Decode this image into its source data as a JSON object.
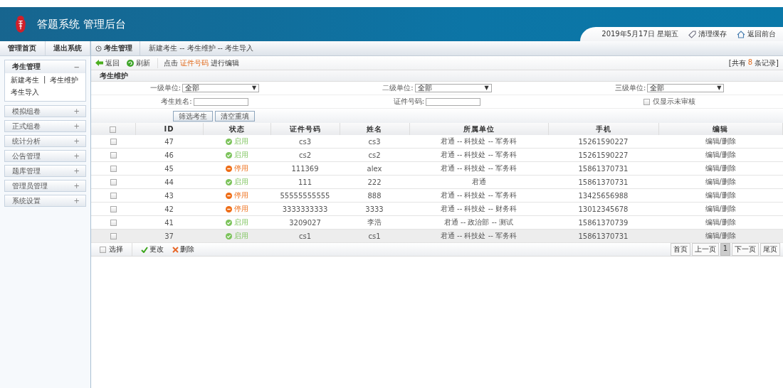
{
  "header": {
    "title": "答题系统 管理后台",
    "date": "2019年5月17日 星期五",
    "actions": [
      {
        "label": "清理缓存",
        "kind": "clear"
      },
      {
        "label": "返回前台",
        "kind": "home"
      }
    ]
  },
  "sidebar": {
    "tabs": [
      "管理首页",
      "退出系统"
    ],
    "groups": [
      {
        "title": "考生管理",
        "toggle": "−",
        "expanded": true,
        "items": [
          "新建考生",
          "考生维护",
          "考生导入"
        ],
        "separator": "|"
      },
      {
        "title": "模拟组卷",
        "toggle": "+",
        "expanded": false
      },
      {
        "title": "正式组卷",
        "toggle": "+",
        "expanded": false
      },
      {
        "title": "统计分析",
        "toggle": "+",
        "expanded": false
      },
      {
        "title": "公告管理",
        "toggle": "+",
        "expanded": false
      },
      {
        "title": "题库管理",
        "toggle": "+",
        "expanded": false
      },
      {
        "title": "管理员管理",
        "toggle": "+",
        "expanded": false
      },
      {
        "title": "系统设置",
        "toggle": "+",
        "expanded": false
      }
    ]
  },
  "breadcrumb": {
    "current": "考生管理",
    "path": "新建考生 -- 考生维护 -- 考生导入"
  },
  "toolbar": {
    "back": "返回",
    "refresh": "刷新",
    "hint_before": "点击",
    "hint_link": "证件号码",
    "hint_after": "进行编辑",
    "count_before": "[共有",
    "count": "8",
    "count_after": "条记录]"
  },
  "section_title": "考生维护",
  "filters": {
    "unit_1": {
      "label": "一级单位:",
      "value": "全部",
      "caret": "▼"
    },
    "unit_2": {
      "label": "二级单位:",
      "value": "全部",
      "caret": "▼"
    },
    "unit_3": {
      "label": "三级单位:",
      "value": "全部",
      "caret": "▼"
    },
    "name": {
      "label": "考生姓名:"
    },
    "id_number": {
      "label": "证件号码:"
    },
    "unreviewed_only": {
      "label": "仅显示未审核",
      "checked": false
    },
    "buttons": [
      "筛选考生",
      "清空重填"
    ]
  },
  "table": {
    "columns": [
      "ID",
      "状态",
      "证件号码",
      "姓名",
      "所属单位",
      "手机",
      "编辑"
    ],
    "rows": [
      {
        "id": "47",
        "status": {
          "kind": "enabled",
          "label": "启用"
        },
        "id_number": "cs3",
        "name": "cs3",
        "unit": "君通 -- 科技处 -- 军务科",
        "phone": "15261590227",
        "edit": "编辑/删除",
        "checked": false,
        "highlighted": false
      },
      {
        "id": "46",
        "status": {
          "kind": "enabled",
          "label": "启用"
        },
        "id_number": "cs2",
        "name": "cs2",
        "unit": "君通 -- 科技处 -- 军务科",
        "phone": "15261590227",
        "edit": "编辑/删除",
        "checked": false,
        "highlighted": false
      },
      {
        "id": "45",
        "status": {
          "kind": "disabled",
          "label": "停用"
        },
        "id_number": "111369",
        "name": "alex",
        "unit": "君通 -- 科技处 -- 军务科",
        "phone": "15861370731",
        "edit": "编辑/删除",
        "checked": false,
        "highlighted": false
      },
      {
        "id": "44",
        "status": {
          "kind": "enabled",
          "label": "启用"
        },
        "id_number": "111",
        "name": "222",
        "unit": "君通",
        "phone": "15861370731",
        "edit": "编辑/删除",
        "checked": false,
        "highlighted": false
      },
      {
        "id": "43",
        "status": {
          "kind": "disabled",
          "label": "停用"
        },
        "id_number": "55555555555",
        "name": "888",
        "unit": "君通 -- 科技处 -- 军务科",
        "phone": "13425656988",
        "edit": "编辑/删除",
        "checked": false,
        "highlighted": false
      },
      {
        "id": "42",
        "status": {
          "kind": "disabled",
          "label": "停用"
        },
        "id_number": "3333333333",
        "name": "3333",
        "unit": "君通 -- 科技处 -- 财务科",
        "phone": "13012345678",
        "edit": "编辑/删除",
        "checked": false,
        "highlighted": false
      },
      {
        "id": "41",
        "status": {
          "kind": "enabled",
          "label": "启用"
        },
        "id_number": "3209027",
        "name": "李浩",
        "unit": "君通 -- 政治部 -- 测试",
        "phone": "15861370739",
        "edit": "编辑/删除",
        "checked": false,
        "highlighted": false
      },
      {
        "id": "37",
        "status": {
          "kind": "enabled",
          "label": "启用"
        },
        "id_number": "cs1",
        "name": "cs1",
        "unit": "君通 -- 科技处 -- 军务科",
        "phone": "15861370731",
        "edit": "编辑/删除",
        "checked": false,
        "highlighted": true
      }
    ],
    "select_all_checked": false
  },
  "footer": {
    "select": {
      "label": "选择",
      "checked": false
    },
    "modify": "更改",
    "delete": "删除",
    "pages": [
      {
        "label": "首页",
        "selected": false
      },
      {
        "label": "上一页",
        "selected": false
      },
      {
        "label": "1",
        "selected": true
      },
      {
        "label": "下一页",
        "selected": false
      },
      {
        "label": "尾页",
        "selected": false
      }
    ]
  }
}
